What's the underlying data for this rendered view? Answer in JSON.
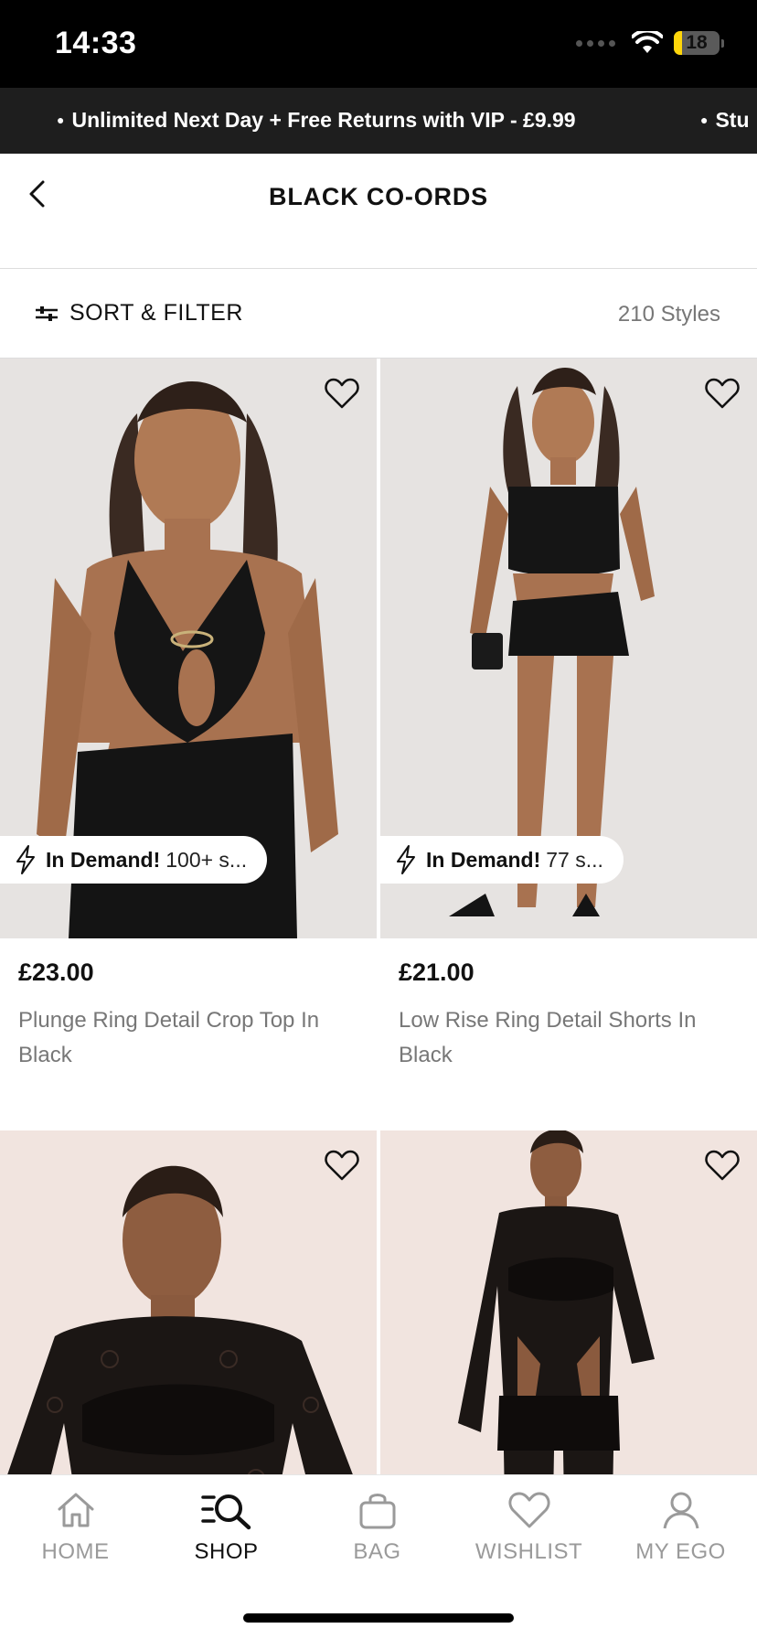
{
  "status_bar": {
    "time": "14:33",
    "battery_level": "18",
    "battery_fraction": 0.18
  },
  "promo": {
    "items": [
      "Unlimited Next Day + Free Returns with VIP - £9.99",
      "Stu"
    ]
  },
  "header": {
    "title": "BLACK CO-ORDS",
    "back_icon": "chevron-left-icon"
  },
  "filter": {
    "label": "SORT & FILTER",
    "icon": "sliders-icon",
    "count": "210 Styles"
  },
  "products": [
    {
      "price": "£23.00",
      "name": "Plunge Ring Detail Crop Top In Black",
      "badge_strong": "In Demand!",
      "badge_detail": "100+ s...",
      "wishlist_icon": "heart-outline-icon"
    },
    {
      "price": "£21.00",
      "name": "Low Rise Ring Detail Shorts In Black",
      "badge_strong": "In Demand!",
      "badge_detail": "77 s...",
      "wishlist_icon": "heart-outline-icon"
    },
    {
      "price": "",
      "name": "",
      "wishlist_icon": "heart-outline-icon"
    },
    {
      "price": "",
      "name": "",
      "wishlist_icon": "heart-outline-icon"
    }
  ],
  "tab_bar": {
    "tabs": [
      {
        "label": "HOME",
        "icon": "home-icon",
        "active": false
      },
      {
        "label": "SHOP",
        "icon": "search-list-icon",
        "active": true
      },
      {
        "label": "BAG",
        "icon": "bag-icon",
        "active": false
      },
      {
        "label": "WISHLIST",
        "icon": "heart-icon",
        "active": false
      },
      {
        "label": "MY EGO",
        "icon": "person-icon",
        "active": false
      }
    ]
  },
  "colors": {
    "status_bar": "#000000",
    "promo_bar": "#1e1e1e",
    "battery": "#ffd60a",
    "muted_text": "#777777",
    "active_tab": "#111111",
    "inactive_tab": "#9a9a9a"
  }
}
